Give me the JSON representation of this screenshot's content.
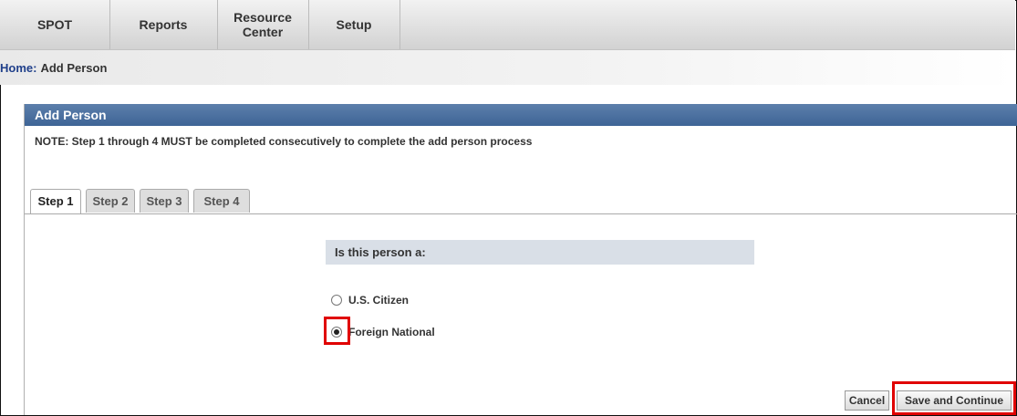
{
  "nav": {
    "items": [
      {
        "label": "SPOT"
      },
      {
        "label": "Reports"
      },
      {
        "label": "Resource Center"
      },
      {
        "label": "Setup"
      }
    ]
  },
  "breadcrumb": {
    "home": "Home",
    "separator": ":",
    "current": "Add Person"
  },
  "panel": {
    "title": "Add Person",
    "note": "NOTE: Step 1 through 4 MUST be completed consecutively to complete the add person process"
  },
  "tabs": [
    {
      "label": "Step 1",
      "active": true
    },
    {
      "label": "Step 2",
      "active": false
    },
    {
      "label": "Step 3",
      "active": false
    },
    {
      "label": "Step 4",
      "active": false
    }
  ],
  "question": {
    "label": "Is this person a:",
    "options": [
      {
        "label": "U.S. Citizen",
        "selected": false
      },
      {
        "label": "Foreign National",
        "selected": true
      }
    ]
  },
  "buttons": {
    "cancel": "Cancel",
    "save_continue": "Save and Continue"
  },
  "colors": {
    "header_blue": "#3e6496",
    "highlight_red": "#e00000",
    "link_blue": "#1f3f8a"
  }
}
